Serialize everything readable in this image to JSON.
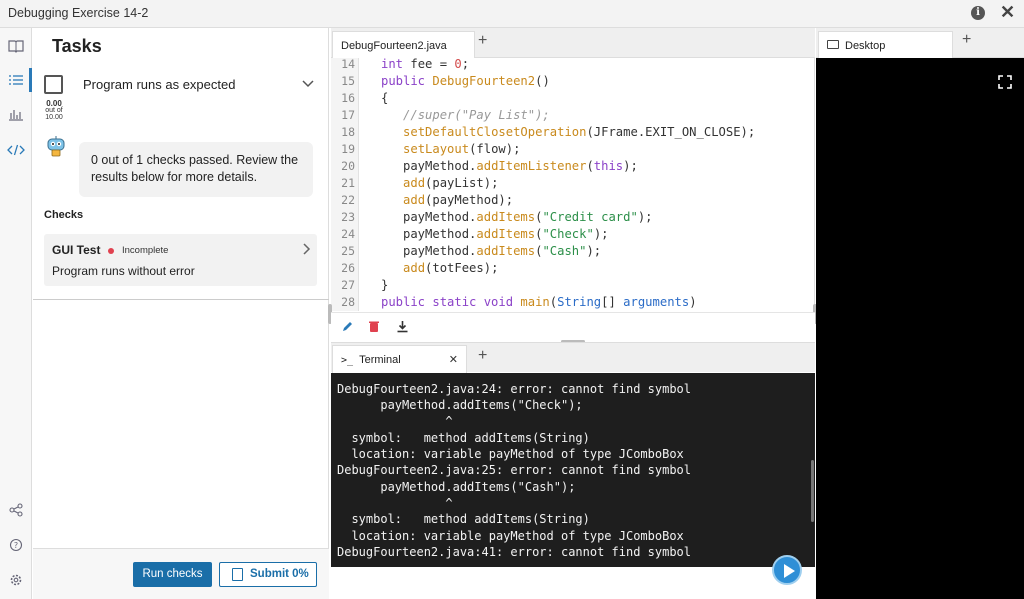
{
  "window": {
    "title": "Debugging Exercise 14-2"
  },
  "rail_icons": [
    "book-icon",
    "tasks-list-icon",
    "chart-icon",
    "code-icon",
    "share-icon",
    "help-icon",
    "settings-icon"
  ],
  "tasks": {
    "title": "Tasks",
    "task_name": "Program runs as expected",
    "score_value": "0.00",
    "score_out_of": "out of",
    "score_max": "10.00",
    "feedback": "0 out of 1 checks passed. Review the results below for more details.",
    "checks_heading": "Checks",
    "check": {
      "name": "GUI Test",
      "status": "Incomplete",
      "description": "Program runs without error"
    },
    "run_checks_label": "Run checks",
    "submit_label": "Submit 0%"
  },
  "editor": {
    "tab_label": "DebugFourteen2.java",
    "lines": [
      {
        "n": "14",
        "code": "int fee = 0;"
      },
      {
        "n": "15",
        "code": "public DebugFourteen2()"
      },
      {
        "n": "16",
        "code": "{"
      },
      {
        "n": "17",
        "code": "//super(\"Pay List\");"
      },
      {
        "n": "18",
        "code": "setDefaultClosetOperation(JFrame.EXIT_ON_CLOSE);"
      },
      {
        "n": "19",
        "code": "setLayout(flow);"
      },
      {
        "n": "20",
        "code": "payMethod.addItemListener(this);"
      },
      {
        "n": "21",
        "code": "add(payList);"
      },
      {
        "n": "22",
        "code": "add(payMethod);"
      },
      {
        "n": "23",
        "code": "payMethod.addItems(\"Credit card\");"
      },
      {
        "n": "24",
        "code": "payMethod.addItems(\"Check\");"
      },
      {
        "n": "25",
        "code": "payMethod.addItems(\"Cash\");"
      },
      {
        "n": "26",
        "code": "add(totFees);"
      },
      {
        "n": "27",
        "code": "}"
      },
      {
        "n": "28",
        "code": "public static void main(String[] arguments)"
      }
    ]
  },
  "terminal": {
    "tab_label": "Terminal",
    "lines": [
      "DebugFourteen2.java:24: error: cannot find symbol",
      "      payMethod.addItems(\"Check\");",
      "               ^",
      "  symbol:   method addItems(String)",
      "  location: variable payMethod of type JComboBox",
      "DebugFourteen2.java:25: error: cannot find symbol",
      "      payMethod.addItems(\"Cash\");",
      "               ^",
      "  symbol:   method addItems(String)",
      "  location: variable payMethod of type JComboBox",
      "DebugFourteen2.java:41: error: cannot find symbol"
    ]
  },
  "desktop": {
    "tab_label": "Desktop"
  },
  "colors": {
    "accent": "#1a6ea8",
    "status_red": "#e0414f",
    "terminal_bg": "#1e1e1e"
  }
}
